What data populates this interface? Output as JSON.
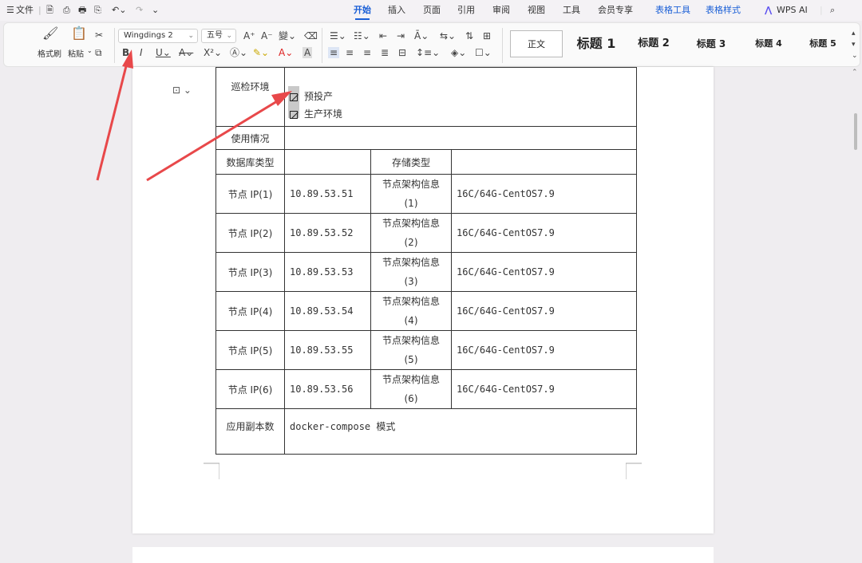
{
  "menu": {
    "hamburger": "☰",
    "file": "文件"
  },
  "tabs": [
    {
      "label": "开始",
      "active": true
    },
    {
      "label": "插入"
    },
    {
      "label": "页面"
    },
    {
      "label": "引用"
    },
    {
      "label": "审阅"
    },
    {
      "label": "视图"
    },
    {
      "label": "工具"
    },
    {
      "label": "会员专享"
    },
    {
      "label": "表格工具",
      "blue": true
    },
    {
      "label": "表格样式",
      "blue": true
    },
    {
      "label": "WPS AI"
    }
  ],
  "ribbon": {
    "format_painter": "格式刷",
    "paste": "粘贴",
    "font_name": "Wingdings 2",
    "font_size": "五号",
    "styles": [
      "正文",
      "标题 1",
      "标题 2",
      "标题 3",
      "标题 4",
      "标题 5"
    ]
  },
  "doc": {
    "inspection_env_label": "巡检环境",
    "env_options": [
      "预投产",
      "生产环境"
    ],
    "usage_label": "使用情况",
    "db_type_label": "数据库类型",
    "storage_type_label": "存储类型",
    "nodes": [
      {
        "label": "节点 IP(1)",
        "ip": "10.89.53.51",
        "arch": "节点架构信息",
        "arch_n": "(1)",
        "spec": "16C/64G-CentOS7.9"
      },
      {
        "label": "节点 IP(2)",
        "ip": "10.89.53.52",
        "arch": "节点架构信息",
        "arch_n": "(2)",
        "spec": "16C/64G-CentOS7.9"
      },
      {
        "label": "节点 IP(3)",
        "ip": "10.89.53.53",
        "arch": "节点架构信息",
        "arch_n": "(3)",
        "spec": "16C/64G-CentOS7.9"
      },
      {
        "label": "节点 IP(4)",
        "ip": "10.89.53.54",
        "arch": "节点架构信息",
        "arch_n": "(4)",
        "spec": "16C/64G-CentOS7.9"
      },
      {
        "label": "节点 IP(5)",
        "ip": "10.89.53.55",
        "arch": "节点架构信息",
        "arch_n": "(5)",
        "spec": "16C/64G-CentOS7.9"
      },
      {
        "label": "节点 IP(6)",
        "ip": "10.89.53.56",
        "arch": "节点架构信息",
        "arch_n": "(6)",
        "spec": "16C/64G-CentOS7.9"
      }
    ],
    "replica_label": "应用副本数",
    "replica_value": "docker-compose 模式"
  },
  "colors": {
    "accent": "#1a5fd6",
    "arrow": "#e8484a"
  }
}
